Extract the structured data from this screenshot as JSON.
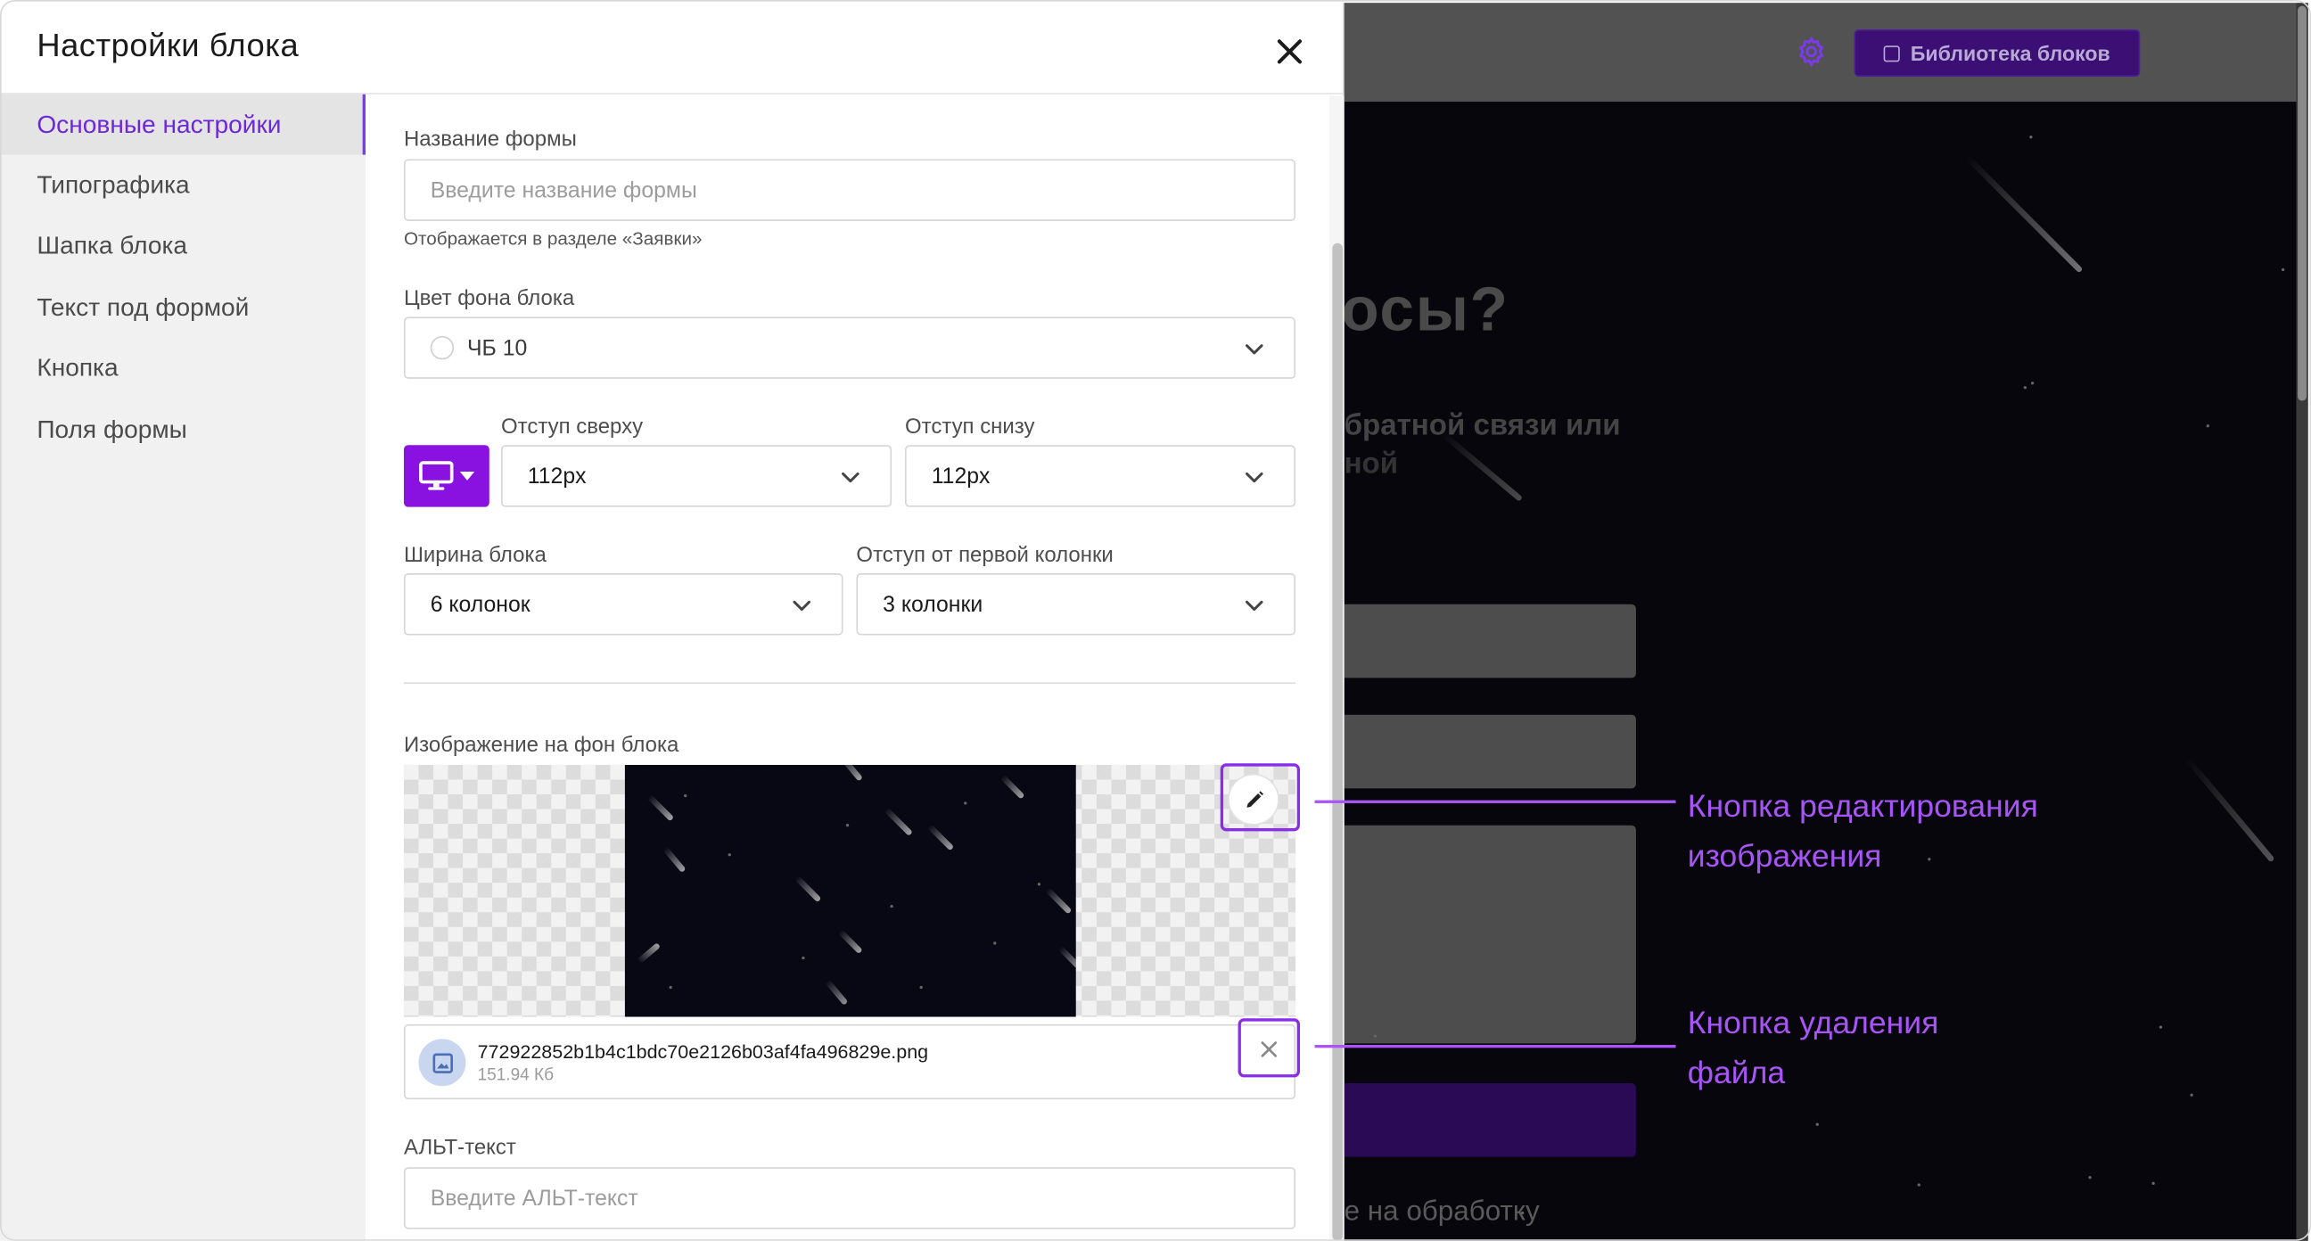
{
  "panel": {
    "title": "Настройки блока",
    "close_icon": "close-icon"
  },
  "nav": {
    "items": [
      {
        "label": "Основные настройки",
        "active": true
      },
      {
        "label": "Типографика",
        "active": false
      },
      {
        "label": "Шапка блока",
        "active": false
      },
      {
        "label": "Текст под формой",
        "active": false
      },
      {
        "label": "Кнопка",
        "active": false
      },
      {
        "label": "Поля формы",
        "active": false
      }
    ]
  },
  "form": {
    "form_name": {
      "label": "Название формы",
      "placeholder": "Введите название формы",
      "hint": "Отображается в разделе «Заявки»"
    },
    "bg_color": {
      "label": "Цвет фона блока",
      "value": "ЧБ 10"
    },
    "device": {
      "icon": "desktop-icon"
    },
    "padding_top": {
      "label": "Отступ сверху",
      "value": "112px"
    },
    "padding_bottom": {
      "label": "Отступ снизу",
      "value": "112px"
    },
    "block_width": {
      "label": "Ширина блока",
      "value": "6 колонок"
    },
    "first_col_offset": {
      "label": "Отступ от первой колонки",
      "value": "3 колонки"
    },
    "bg_image": {
      "label": "Изображение на фон блока",
      "file_name": "772922852b1b4c1bdc70e2126b03af4fa496829e.png",
      "file_size": "151.94 Кб"
    },
    "alt_text": {
      "label": "АЛЬТ-текст",
      "placeholder": "Введите АЛЬТ-текст"
    }
  },
  "annotations": {
    "edit_line1": "Кнопка редактирования",
    "edit_line2": "изображения",
    "delete_line1": "Кнопка удаления",
    "delete_line2": "файла"
  },
  "background_site": {
    "library_button": "Библиотека блоков",
    "heading_fragment": "осы?",
    "subtitle_fragment": "братной связи или",
    "subtitle_fragment2": "ной",
    "consent_fragment": "е на обработку"
  },
  "colors": {
    "accent": "#7c3aed",
    "device_button": "#8a12e0",
    "annotation": "#a855f7",
    "nav_bg": "#f1f1f1"
  }
}
